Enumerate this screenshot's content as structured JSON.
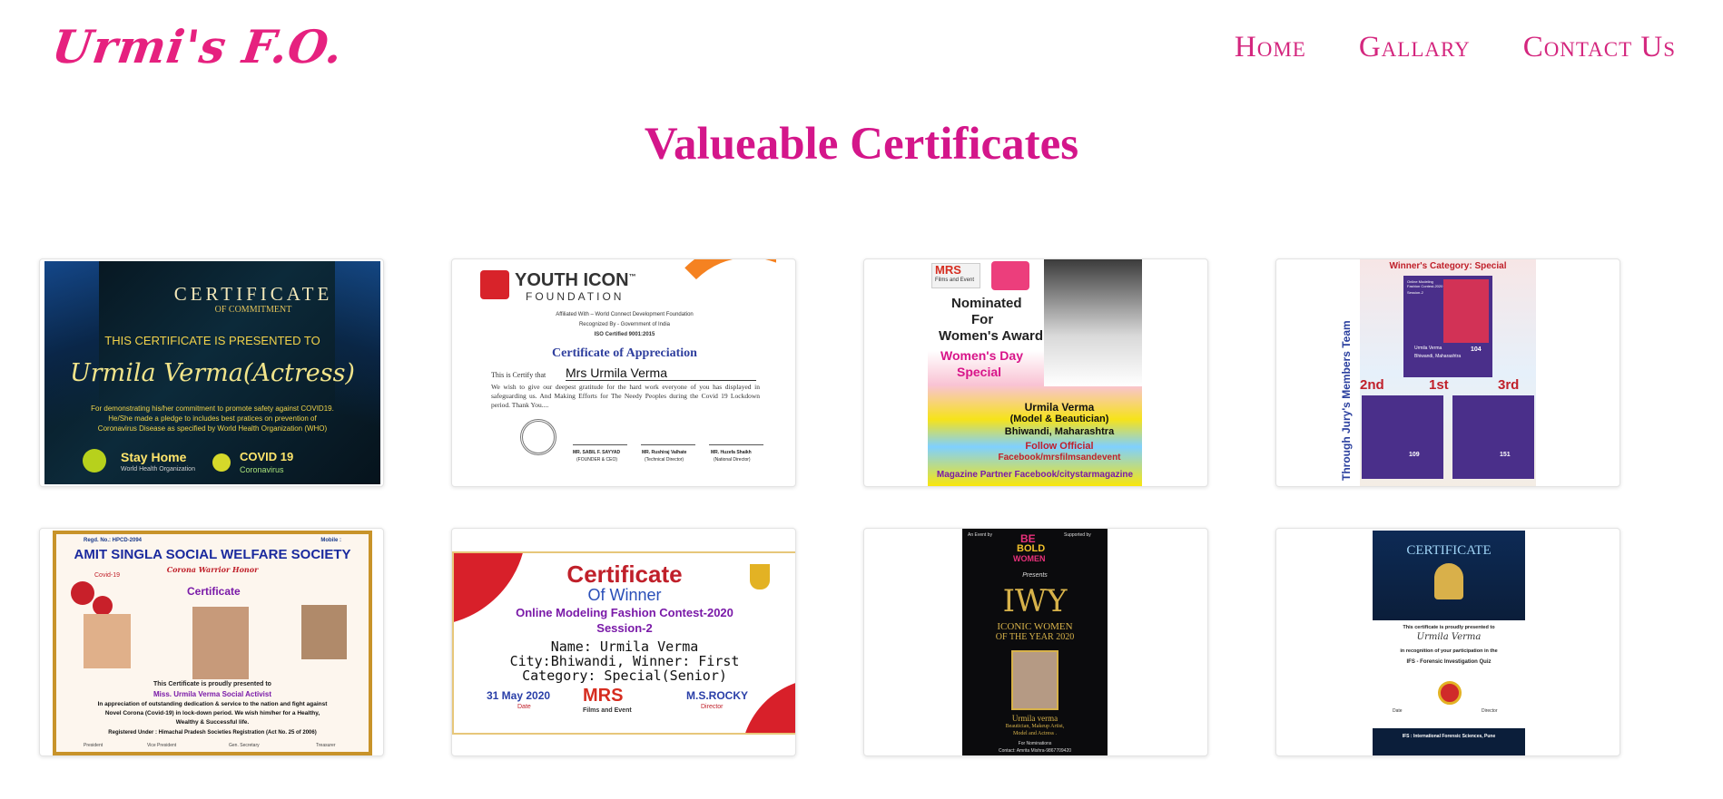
{
  "site": {
    "logo": "Urmi's F.O.",
    "nav": [
      "Home",
      "Gallary",
      "Contact Us"
    ],
    "heading": "Valueable Certificates"
  },
  "colors": {
    "brand_pink": "#e6217f",
    "heading_magenta": "#d4168a",
    "card_border": "#e3e3e3"
  },
  "certificates": [
    {
      "title": "CERTIFICATE",
      "subtitle": "OF COMMITMENT",
      "presented": "THIS CERTIFICATE IS PRESENTED TO",
      "name": "Urmila Verma(Actress)",
      "body1": "For demonstrating his/her commitment to promote safety against COVID19.",
      "body2": "He/She made a pledge to includes best pratices on prevention of",
      "body3": "Coronavirus Disease as specified by World Health Organization (WHO)",
      "stay": "Stay Home",
      "who": "World Health Organization",
      "covid": "COVID 19",
      "coronavirus": "Coronavirus"
    },
    {
      "org": "YOUTH ICON",
      "org_tm": "™",
      "foundation": "FOUNDATION",
      "affiliated": "Affiliated With – World Connect Development Foundation",
      "recognized": "Recognized By - Government of India",
      "iso": "ISO Certified 9001:2015",
      "title": "Certificate of Appreciation",
      "certify": "This is Certify that",
      "name": "Mrs  Urmila Verma",
      "body": "We wish to give our deepest gratitude for the hard work everyone of you has displayed in safeguarding us. And Making Efforts for The Needy Peoples during the Covid 19 Lockdown period. Thank You....",
      "sig1_name": "MR. SABIL F. SAYYAD",
      "sig1_role": "(FOUNDER & CEO)",
      "sig2_name": "MR. Rushiraj Valhate",
      "sig2_role": "(Technical Director)",
      "sig3_name": "MR. Huzefa Shaikh",
      "sig3_role": "(National Director)"
    },
    {
      "brand": "MRS",
      "brand_sub": "Films and Event",
      "nominated": "Nominated",
      "for": "For",
      "award": "Women's Award",
      "day": "Women's Day",
      "special": "Special",
      "name": "Urmila Verma",
      "role": "(Model & Beautician)",
      "city": "Bhiwandi, Maharashtra",
      "follow": "Follow Official",
      "fb": "Facebook/mrsfilmsandevent",
      "partner": "Magazine Partner Facebook/citystarmagazine"
    },
    {
      "top": "Winner's Category: Special",
      "side": "Through Jury's Members Team",
      "contest": "Online Modeling Fashion Contest-2020",
      "session": "Session-2",
      "winner_name": "Urmila Verma",
      "winner_city": "Bhiwandi, Maharashtra",
      "winner_no": "104",
      "r1": "2nd",
      "r2": "1st",
      "r3": "3rd",
      "left_no": "109",
      "right_no": "151"
    },
    {
      "reg": "Regd. No.: HPCD-2094",
      "mob": "Mobile :",
      "society": "AMIT SINGLA SOCIAL WELFARE SOCIETY",
      "honour": "Corona Warrior Honor",
      "covid": "Covid-19",
      "cert": "Certificate",
      "presented": "This Certificate is proudly presented to",
      "name": "Miss. Urmila Verma Social Activist",
      "body1": "In appreciation of outstanding dedication & service to the nation and fight against",
      "body2": "Novel Corona (Covid-19) in lock-down period. We wish him/her for a Healthy,",
      "body3": "Wealthy & Successful life.",
      "registered": "Registered Under : Himachal Pradesh Societies Registration (Act No. 25 of 2006)",
      "s1": "President",
      "s2": "Vice President",
      "s3": "Gen. Secretary",
      "s4": "Treasurer"
    },
    {
      "title": "Certificate",
      "of": "Of Winner",
      "contest": "Online Modeling Fashion Contest-2020",
      "session": "Session-2",
      "name": "Name: Urmila Verma",
      "city": "City:Bhiwandi, Winner: First",
      "category": "Category: Special(Senior)",
      "date": "31 May 2020",
      "date_label": "Date",
      "brand": "MRS",
      "brand_sub": "Films and Event",
      "director": "M.S.ROCKY",
      "director_label": "Director"
    },
    {
      "event": "An Event by",
      "supported": "Supported by",
      "be": "BE",
      "bold": "BOLD",
      "women": "WOMEN",
      "presents": "Presents",
      "iwy": "IWY",
      "iconic": "ICONIC WOMEN",
      "year": "OF THE YEAR 2020",
      "name": "Urmila verma",
      "role1": "Beautician, Makeup Artist,",
      "role2": "Model and Actress .",
      "nominations": "For Nominations",
      "contact": "Contact: Amrita Mishra-9867709420"
    },
    {
      "title": "CERTIFICATE",
      "proud": "This certificate is proudly presented to",
      "name": "Urmila Verma",
      "recog": "in recognition of your participation in the",
      "quiz": "IFS - Forensic Investigation Quiz",
      "date": "Date",
      "director": "Director",
      "footer": "IFS : International Forensic Sciences, Pune"
    }
  ]
}
